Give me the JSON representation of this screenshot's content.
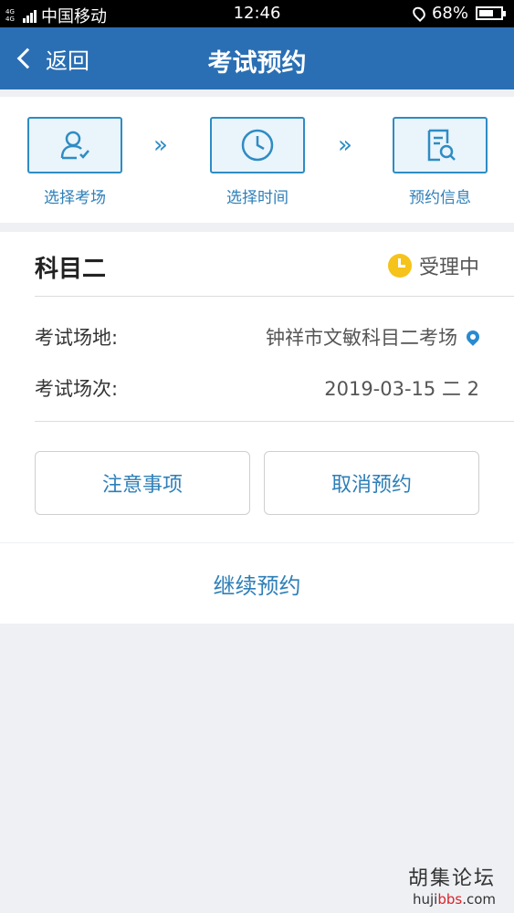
{
  "status_bar": {
    "network_type": "4G 4G",
    "carrier": "中国移动",
    "time": "12:46",
    "battery": "68%",
    "battery_level": 0.68
  },
  "nav": {
    "back_label": "返回",
    "title": "考试预约"
  },
  "steps": [
    {
      "label": "选择考场",
      "icon": "person-check-icon"
    },
    {
      "label": "选择时间",
      "icon": "clock-icon"
    },
    {
      "label": "预约信息",
      "icon": "document-search-icon"
    }
  ],
  "card": {
    "subject": "科目二",
    "status": "受理中",
    "rows": [
      {
        "label": "考试场地:",
        "value": "钟祥市文敏科目二考场"
      },
      {
        "label": "考试场次:",
        "value": "2019-03-15 二 2"
      }
    ],
    "buttons": {
      "notice": "注意事项",
      "cancel": "取消预约"
    }
  },
  "continue_label": "继续预约",
  "watermark": {
    "name": "胡集论坛",
    "url_prefix": "hujibbs",
    "url_bbs": "bbs",
    "url_suffix": ".com",
    "url_host": "huji"
  },
  "colors": {
    "nav_bg": "#2a6fb4",
    "accent": "#2e7fb8",
    "status_yellow": "#f5c31a"
  }
}
